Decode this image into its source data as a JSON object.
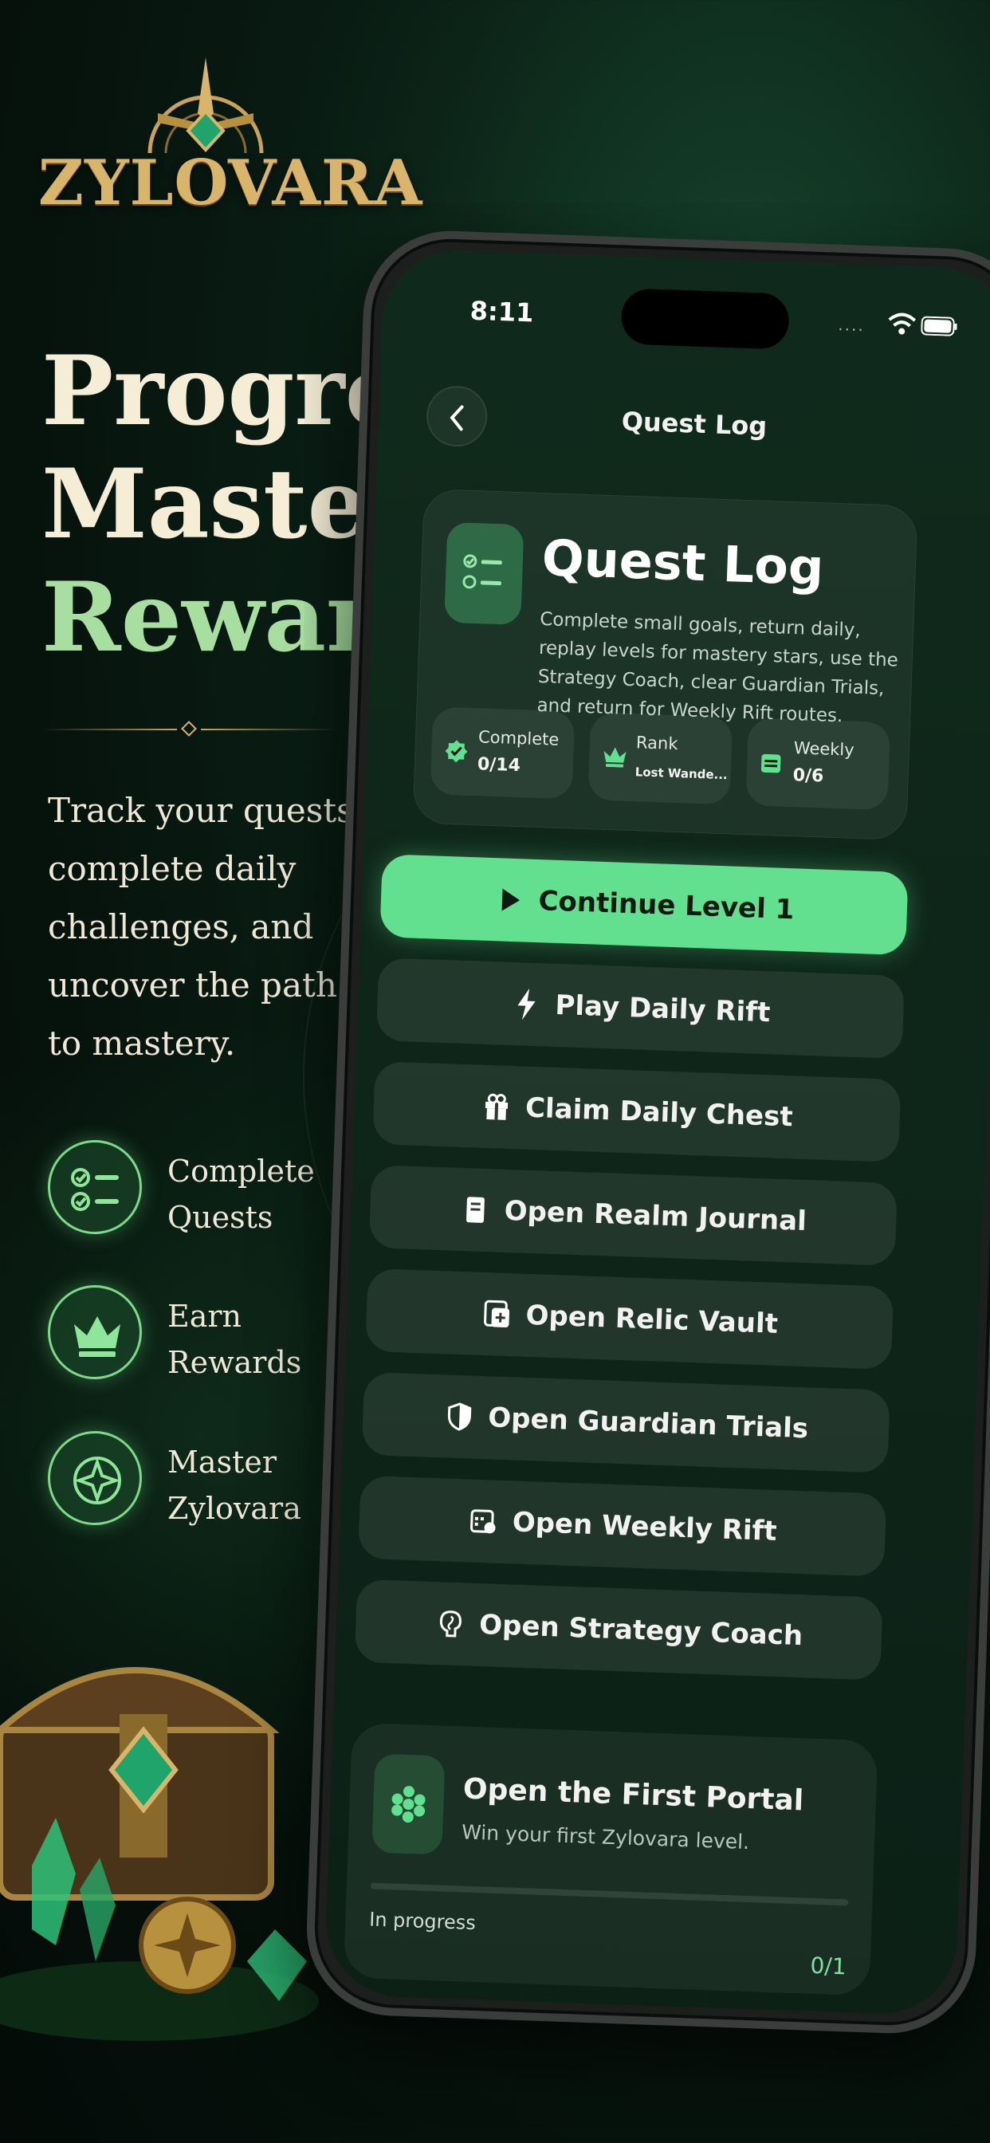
{
  "brand": {
    "logo_text": "ZYLOVARA"
  },
  "headline": {
    "line1": "Progress,",
    "line2": "Mastery,",
    "line3": "Rewards"
  },
  "subtext": {
    "l1": "Track your quests,",
    "l2": "complete daily",
    "l3": "challenges, and",
    "l4": "uncover the path",
    "l5": "to mastery."
  },
  "features": [
    {
      "icon": "checklist-icon",
      "line1": "Complete",
      "line2": "Quests"
    },
    {
      "icon": "crown-icon",
      "line1": "Earn",
      "line2": "Rewards"
    },
    {
      "icon": "compass-star-icon",
      "line1": "Master",
      "line2": "Zylovara"
    }
  ],
  "phone": {
    "status_time": "8:11",
    "nav_title": "Quest Log",
    "hero": {
      "title": "Quest Log",
      "description": "Complete small goals, return daily, replay levels for mastery stars, use the Strategy Coach, clear Guardian Trials, and return for Weekly Rift routes."
    },
    "stats": [
      {
        "icon": "check-badge-icon",
        "label": "Complete",
        "value": "0/14"
      },
      {
        "icon": "crown-icon",
        "label": "Rank",
        "value": "Lost Wande..."
      },
      {
        "icon": "calendar-icon",
        "label": "Weekly",
        "value": "0/6"
      }
    ],
    "buttons": [
      {
        "icon": "play-icon",
        "label": "Continue Level 1"
      },
      {
        "icon": "bolt-icon",
        "label": "Play Daily Rift"
      },
      {
        "icon": "gift-icon",
        "label": "Claim Daily Chest"
      },
      {
        "icon": "journal-icon",
        "label": "Open Realm Journal"
      },
      {
        "icon": "vault-icon",
        "label": "Open Relic Vault"
      },
      {
        "icon": "shield-icon",
        "label": "Open Guardian Trials"
      },
      {
        "icon": "calendar-icon",
        "label": "Open Weekly Rift"
      },
      {
        "icon": "brain-icon",
        "label": "Open Strategy Coach"
      }
    ],
    "portal": {
      "title": "Open the First Portal",
      "subtitle": "Win your first Zylovara level.",
      "status": "In progress",
      "count": "0/1",
      "progress": 0
    }
  },
  "colors": {
    "accent_green": "#63e08f",
    "gold": "#d8b56a",
    "headline_green": "#a8dfa0"
  }
}
